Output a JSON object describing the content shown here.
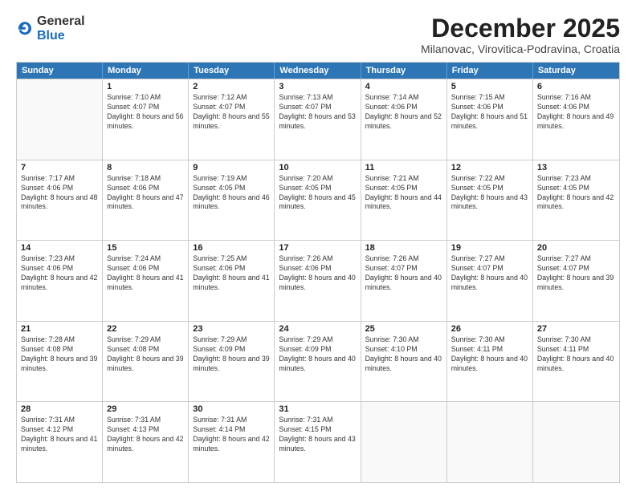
{
  "header": {
    "logo_general": "General",
    "logo_blue": "Blue",
    "month_title": "December 2025",
    "location": "Milanovac, Virovitica-Podravina, Croatia"
  },
  "calendar": {
    "days_of_week": [
      "Sunday",
      "Monday",
      "Tuesday",
      "Wednesday",
      "Thursday",
      "Friday",
      "Saturday"
    ],
    "weeks": [
      [
        {
          "day": "",
          "empty": true
        },
        {
          "day": "1",
          "sunrise": "Sunrise: 7:10 AM",
          "sunset": "Sunset: 4:07 PM",
          "daylight": "Daylight: 8 hours and 56 minutes."
        },
        {
          "day": "2",
          "sunrise": "Sunrise: 7:12 AM",
          "sunset": "Sunset: 4:07 PM",
          "daylight": "Daylight: 8 hours and 55 minutes."
        },
        {
          "day": "3",
          "sunrise": "Sunrise: 7:13 AM",
          "sunset": "Sunset: 4:07 PM",
          "daylight": "Daylight: 8 hours and 53 minutes."
        },
        {
          "day": "4",
          "sunrise": "Sunrise: 7:14 AM",
          "sunset": "Sunset: 4:06 PM",
          "daylight": "Daylight: 8 hours and 52 minutes."
        },
        {
          "day": "5",
          "sunrise": "Sunrise: 7:15 AM",
          "sunset": "Sunset: 4:06 PM",
          "daylight": "Daylight: 8 hours and 51 minutes."
        },
        {
          "day": "6",
          "sunrise": "Sunrise: 7:16 AM",
          "sunset": "Sunset: 4:06 PM",
          "daylight": "Daylight: 8 hours and 49 minutes."
        }
      ],
      [
        {
          "day": "7",
          "sunrise": "Sunrise: 7:17 AM",
          "sunset": "Sunset: 4:06 PM",
          "daylight": "Daylight: 8 hours and 48 minutes."
        },
        {
          "day": "8",
          "sunrise": "Sunrise: 7:18 AM",
          "sunset": "Sunset: 4:06 PM",
          "daylight": "Daylight: 8 hours and 47 minutes."
        },
        {
          "day": "9",
          "sunrise": "Sunrise: 7:19 AM",
          "sunset": "Sunset: 4:05 PM",
          "daylight": "Daylight: 8 hours and 46 minutes."
        },
        {
          "day": "10",
          "sunrise": "Sunrise: 7:20 AM",
          "sunset": "Sunset: 4:05 PM",
          "daylight": "Daylight: 8 hours and 45 minutes."
        },
        {
          "day": "11",
          "sunrise": "Sunrise: 7:21 AM",
          "sunset": "Sunset: 4:05 PM",
          "daylight": "Daylight: 8 hours and 44 minutes."
        },
        {
          "day": "12",
          "sunrise": "Sunrise: 7:22 AM",
          "sunset": "Sunset: 4:05 PM",
          "daylight": "Daylight: 8 hours and 43 minutes."
        },
        {
          "day": "13",
          "sunrise": "Sunrise: 7:23 AM",
          "sunset": "Sunset: 4:05 PM",
          "daylight": "Daylight: 8 hours and 42 minutes."
        }
      ],
      [
        {
          "day": "14",
          "sunrise": "Sunrise: 7:23 AM",
          "sunset": "Sunset: 4:06 PM",
          "daylight": "Daylight: 8 hours and 42 minutes."
        },
        {
          "day": "15",
          "sunrise": "Sunrise: 7:24 AM",
          "sunset": "Sunset: 4:06 PM",
          "daylight": "Daylight: 8 hours and 41 minutes."
        },
        {
          "day": "16",
          "sunrise": "Sunrise: 7:25 AM",
          "sunset": "Sunset: 4:06 PM",
          "daylight": "Daylight: 8 hours and 41 minutes."
        },
        {
          "day": "17",
          "sunrise": "Sunrise: 7:26 AM",
          "sunset": "Sunset: 4:06 PM",
          "daylight": "Daylight: 8 hours and 40 minutes."
        },
        {
          "day": "18",
          "sunrise": "Sunrise: 7:26 AM",
          "sunset": "Sunset: 4:07 PM",
          "daylight": "Daylight: 8 hours and 40 minutes."
        },
        {
          "day": "19",
          "sunrise": "Sunrise: 7:27 AM",
          "sunset": "Sunset: 4:07 PM",
          "daylight": "Daylight: 8 hours and 40 minutes."
        },
        {
          "day": "20",
          "sunrise": "Sunrise: 7:27 AM",
          "sunset": "Sunset: 4:07 PM",
          "daylight": "Daylight: 8 hours and 39 minutes."
        }
      ],
      [
        {
          "day": "21",
          "sunrise": "Sunrise: 7:28 AM",
          "sunset": "Sunset: 4:08 PM",
          "daylight": "Daylight: 8 hours and 39 minutes."
        },
        {
          "day": "22",
          "sunrise": "Sunrise: 7:29 AM",
          "sunset": "Sunset: 4:08 PM",
          "daylight": "Daylight: 8 hours and 39 minutes."
        },
        {
          "day": "23",
          "sunrise": "Sunrise: 7:29 AM",
          "sunset": "Sunset: 4:09 PM",
          "daylight": "Daylight: 8 hours and 39 minutes."
        },
        {
          "day": "24",
          "sunrise": "Sunrise: 7:29 AM",
          "sunset": "Sunset: 4:09 PM",
          "daylight": "Daylight: 8 hours and 40 minutes."
        },
        {
          "day": "25",
          "sunrise": "Sunrise: 7:30 AM",
          "sunset": "Sunset: 4:10 PM",
          "daylight": "Daylight: 8 hours and 40 minutes."
        },
        {
          "day": "26",
          "sunrise": "Sunrise: 7:30 AM",
          "sunset": "Sunset: 4:11 PM",
          "daylight": "Daylight: 8 hours and 40 minutes."
        },
        {
          "day": "27",
          "sunrise": "Sunrise: 7:30 AM",
          "sunset": "Sunset: 4:11 PM",
          "daylight": "Daylight: 8 hours and 40 minutes."
        }
      ],
      [
        {
          "day": "28",
          "sunrise": "Sunrise: 7:31 AM",
          "sunset": "Sunset: 4:12 PM",
          "daylight": "Daylight: 8 hours and 41 minutes."
        },
        {
          "day": "29",
          "sunrise": "Sunrise: 7:31 AM",
          "sunset": "Sunset: 4:13 PM",
          "daylight": "Daylight: 8 hours and 42 minutes."
        },
        {
          "day": "30",
          "sunrise": "Sunrise: 7:31 AM",
          "sunset": "Sunset: 4:14 PM",
          "daylight": "Daylight: 8 hours and 42 minutes."
        },
        {
          "day": "31",
          "sunrise": "Sunrise: 7:31 AM",
          "sunset": "Sunset: 4:15 PM",
          "daylight": "Daylight: 8 hours and 43 minutes."
        },
        {
          "day": "",
          "empty": true
        },
        {
          "day": "",
          "empty": true
        },
        {
          "day": "",
          "empty": true
        }
      ]
    ]
  }
}
